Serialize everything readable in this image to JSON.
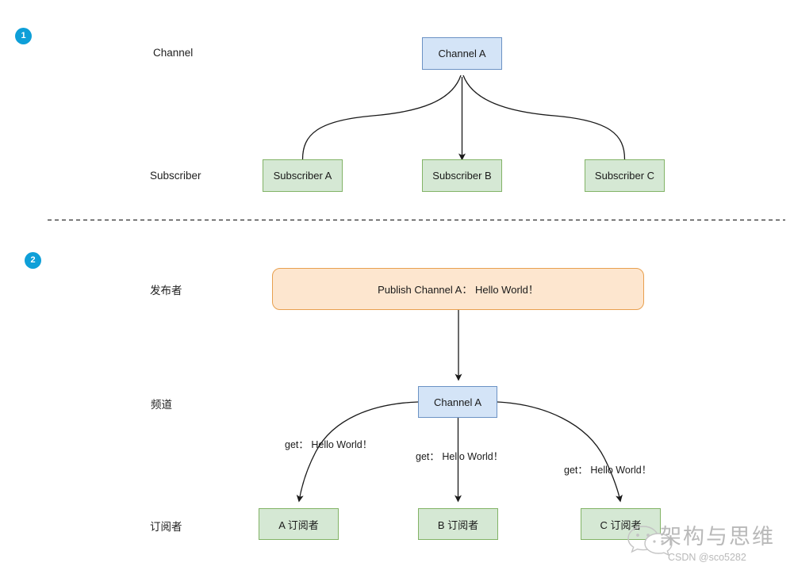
{
  "diagram": {
    "title": "Redis Pub/Sub subscribe and publish flow",
    "background_color": "#ffffff",
    "divider": {
      "style": "dashed",
      "color": "#2b2b2b"
    },
    "colors": {
      "badge": "#0e9fd8",
      "channel_fill": "#d4e4f7",
      "channel_stroke": "#6b92c4",
      "subscriber_fill": "#d5e8d4",
      "subscriber_stroke": "#82b366",
      "publish_fill": "#fde6cf",
      "publish_stroke": "#e8a04f",
      "edge": "#1a1a1a",
      "watermark": "#b9b9b9"
    }
  },
  "sections": [
    {
      "badge": "1",
      "row_labels": {
        "channel": "Channel",
        "subscriber": "Subscriber"
      },
      "channel_node": "Channel A",
      "subscriber_nodes": [
        "Subscriber A",
        "Subscriber B",
        "Subscriber C"
      ]
    },
    {
      "badge": "2",
      "row_labels": {
        "publisher": "发布者",
        "channel": "频道",
        "subscriber": "订阅者"
      },
      "publish_node": "Publish  Channel A： Hello World！",
      "channel_node": "Channel A",
      "subscriber_nodes": [
        "A 订阅者",
        "B 订阅者",
        "C 订阅者"
      ],
      "edge_labels": [
        "get：  Hello World！",
        "get：  Hello World！",
        "get：  Hello World！"
      ]
    }
  ],
  "watermark": {
    "icon": "wechat-icon",
    "brand": "架构与思维",
    "credit": "CSDN @sco5282"
  }
}
